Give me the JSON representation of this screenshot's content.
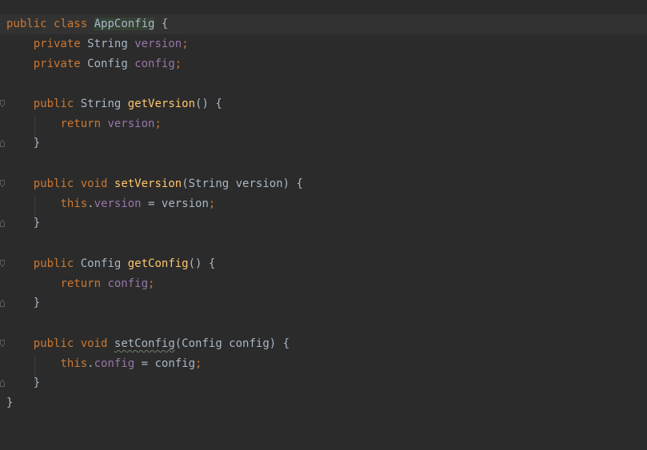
{
  "editor": {
    "language": "Java",
    "colors": {
      "background": "#2b2b2b",
      "current_line": "#323232",
      "keyword": "#cc7832",
      "field": "#9876aa",
      "method": "#ffc66d",
      "text": "#a9b7c6"
    },
    "class_decl": {
      "kw_public": "public",
      "kw_class": "class",
      "name": "AppConfig",
      "open": "{"
    },
    "field_version": {
      "kw": "private",
      "type": "String",
      "name": "version",
      "semi": ";"
    },
    "field_config": {
      "kw": "private",
      "type": "Config",
      "name": "config",
      "semi": ";"
    },
    "get_version": {
      "kw": "public",
      "type": "String",
      "name": "getVersion",
      "params": "()",
      "open": "{",
      "ret_kw": "return",
      "ret_val": "version",
      "semi": ";",
      "close": "}"
    },
    "set_version": {
      "kw_public": "public",
      "kw_void": "void",
      "name": "setVersion",
      "params": "(String version)",
      "open": "{",
      "this_kw": "this",
      "dot": ".",
      "field": "version",
      "assign": " = version",
      "semi": ";",
      "close": "}"
    },
    "get_config": {
      "kw": "public",
      "type": "Config",
      "name": "getConfig",
      "params": "()",
      "open": "{",
      "ret_kw": "return",
      "ret_val": "config",
      "semi": ";",
      "close": "}"
    },
    "set_config": {
      "kw_public": "public",
      "kw_void": "void",
      "name": "setConfig",
      "params": "(Config config)",
      "open": "{",
      "this_kw": "this",
      "dot": ".",
      "field": "config",
      "assign": " = config",
      "semi": ";",
      "close": "}"
    },
    "class_close": "}",
    "icons": [
      "fold-marker-icon"
    ]
  }
}
